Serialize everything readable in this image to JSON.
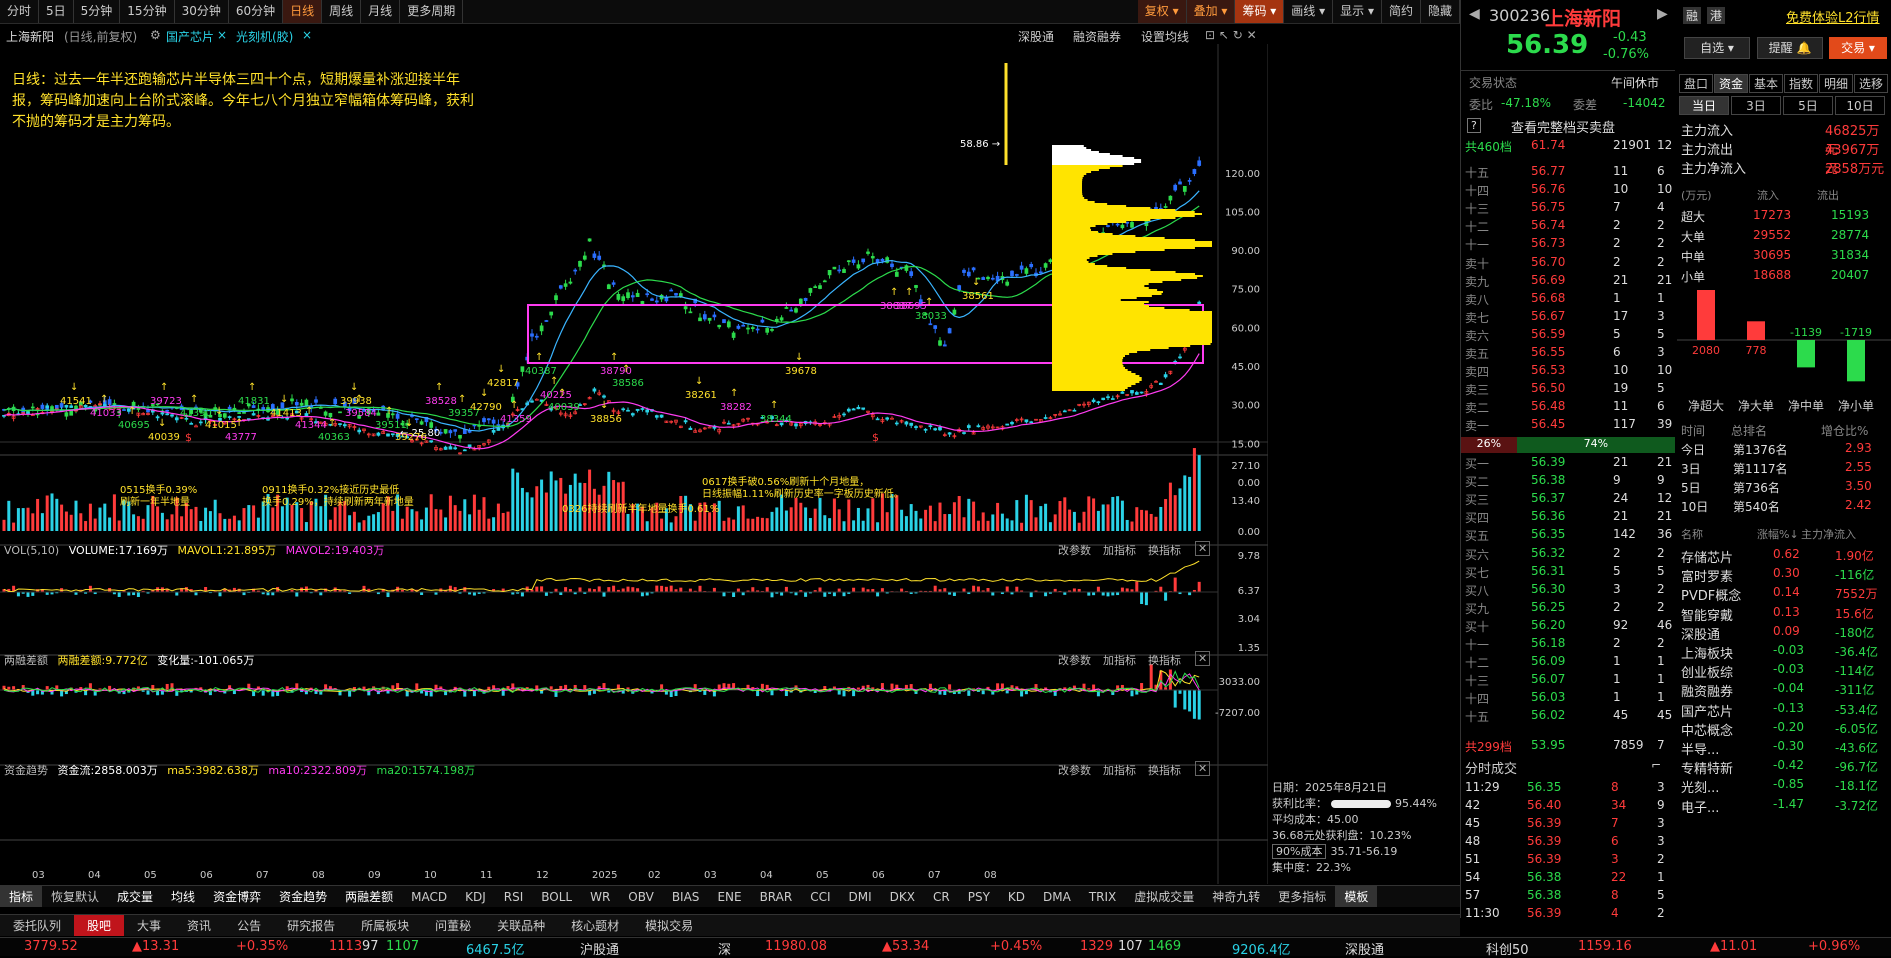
{
  "toolbar": {
    "periods": [
      "分时",
      "5日",
      "5分钟",
      "15分钟",
      "30分钟",
      "60分钟",
      "日线",
      "周线",
      "月线",
      "更多周期"
    ],
    "active": "日线",
    "right": [
      "复权",
      "叠加",
      "筹码",
      "画线",
      "显示",
      "简约",
      "隐藏"
    ]
  },
  "header": {
    "title": "上海新阳",
    "sub": "(日线,前复权)",
    "tag1": "国产芯片",
    "tag2": "光刻机(胶)",
    "links": [
      "深股通",
      "融资融券",
      "设置均线"
    ]
  },
  "annotation": "日线：过去一年半还跑输芯片半导体三四十个点，短期爆量补涨迎接半年报，筹码峰加速向上台阶式滚峰。今年七八个月独立窄幅箱体筹码峰，获利不抛的筹码才是主力筹码。",
  "price_axis": [
    "120.00",
    "105.00",
    "90.00",
    "75.00",
    "60.00",
    "45.00",
    "30.00",
    "15.00",
    "0.00"
  ],
  "markers": {
    "high": "58.86",
    "low": "25.80"
  },
  "chart_labels": [
    "41541",
    "41033",
    "40695",
    "40039",
    "39723",
    "41390",
    "41015",
    "43777",
    "41831",
    "41413",
    "41344",
    "40363",
    "39938",
    "39584",
    "39511",
    "39276",
    "38528",
    "39357",
    "42790",
    "41359",
    "40387",
    "42817",
    "40225",
    "40039",
    "38856",
    "38790",
    "38586",
    "38261",
    "38282",
    "38344",
    "39678",
    "38837",
    "38033",
    "38561",
    "38695"
  ],
  "vol": {
    "title": "VOL(5,10)",
    "volume": "VOLUME:17.169万",
    "ma1": "MAVOL1:21.895万",
    "ma2": "MAVOL2:19.403万",
    "axis": [
      "27.10",
      "13.40",
      "0.00"
    ],
    "notes": [
      "0515换手0.39%",
      "刷新一年半地量",
      "0911换手0.32%接近历史最低",
      "换手0.29%，持续刷新两年新地量",
      "0326持续刷新半年地量换手0.61%",
      "0617换手破0.56%刷新十个月地量，",
      "日线振幅1.11%刷新历史率一字板历史新低。"
    ]
  },
  "margin": {
    "title": "两融差额",
    "val": "两融差额:9.772亿",
    "chg": "变化量:-101.065万",
    "axis": [
      "9.78",
      "6.37",
      "3.04"
    ]
  },
  "flow": {
    "title": "资金趋势",
    "val": "资金流:2858.003万",
    "ma5": "ma5:3982.638万",
    "ma10": "ma10:2322.809万",
    "ma20": "ma20:1574.198万",
    "axis": [
      "1.35",
      "3033.00",
      "-7207.00"
    ]
  },
  "panel_btns": [
    "改参数",
    "加指标",
    "换指标"
  ],
  "chip": {
    "date": "日期：2025年8月21日",
    "ratio_lbl": "获利比率：",
    "ratio": "95.44%",
    "avg": "平均成本：45.00",
    "cost_lbl": "36.68元处获利盘：10.23%",
    "cost90": "90%成本",
    "cost_range": "35.71-56.19",
    "conc": "集中度：22.3%"
  },
  "xaxis": [
    "03",
    "04",
    "05",
    "06",
    "07",
    "08",
    "09",
    "10",
    "11",
    "12",
    "2025",
    "02",
    "03",
    "04",
    "05",
    "06",
    "07",
    "08"
  ],
  "bottom_tabs": [
    "指标",
    "恢复默认",
    "成交量",
    "均线",
    "资金博弈",
    "资金趋势",
    "两融差额",
    "MACD",
    "KDJ",
    "RSI",
    "BOLL",
    "WR",
    "OBV",
    "BIAS",
    "ENE",
    "BRAR",
    "CCI",
    "DMI",
    "DKX",
    "CR",
    "PSY",
    "KD",
    "DMA",
    "TRIX",
    "虚拟成交量",
    "神奇九转",
    "更多指标",
    "模板"
  ],
  "lower_tabs": [
    "委托队列",
    "股吧",
    "大事",
    "资讯",
    "公告",
    "研究报告",
    "所属板块",
    "问董秘",
    "关联品种",
    "核心题材",
    "模拟交易"
  ],
  "status": {
    "sh": "3779.52",
    "sh_chg": "▲13.31",
    "sh_pct": "+0.35%",
    "sh_up": "1113",
    "sh_eq": "97",
    "sh_dn": "1107",
    "sh_amt": "6467.5亿",
    "hgt": "沪股通",
    "sz_lbl": "深",
    "sz": "11980.08",
    "sz_chg": "▲53.34",
    "sz_pct": "+0.45%",
    "sz_up": "1329",
    "sz_eq": "107",
    "sz_dn": "1469",
    "sz_amt": "9206.4亿",
    "sgt": "深股通",
    "kc": "科创50",
    "kc_v": "1159.16",
    "kc_chg": "▲11.01",
    "kc_pct": "+0.96%"
  },
  "quote": {
    "code": "300236",
    "name": "上海新阳",
    "price": "56.39",
    "chg": "-0.43",
    "pct": "-0.76%",
    "btns": [
      "融",
      "港"
    ],
    "free": "免费体验L2行情",
    "zixuan": "自选",
    "remind": "提醒",
    "trade": "交易"
  },
  "trade_state": {
    "label": "交易状态",
    "value": "午间休市",
    "wb_lbl": "委比",
    "wb": "-47.18%",
    "wc_lbl": "委差",
    "wc": "-14042",
    "full": "查看完整档买卖盘"
  },
  "ask_total": {
    "lbl": "共460档",
    "p": "61.74",
    "v": "21901",
    "n": "12"
  },
  "asks": [
    [
      "十五",
      "56.77",
      "11",
      "6"
    ],
    [
      "十四",
      "56.76",
      "10",
      "10"
    ],
    [
      "十三",
      "56.75",
      "7",
      "4"
    ],
    [
      "十二",
      "56.74",
      "2",
      "2"
    ],
    [
      "十一",
      "56.73",
      "2",
      "2"
    ],
    [
      "卖十",
      "56.70",
      "2",
      "2"
    ],
    [
      "卖九",
      "56.69",
      "21",
      "21"
    ],
    [
      "卖八",
      "56.68",
      "1",
      "1"
    ],
    [
      "卖七",
      "56.67",
      "17",
      "3"
    ],
    [
      "卖六",
      "56.59",
      "5",
      "5"
    ],
    [
      "卖五",
      "56.55",
      "6",
      "3"
    ],
    [
      "卖四",
      "56.53",
      "10",
      "10"
    ],
    [
      "卖三",
      "56.50",
      "19",
      "5"
    ],
    [
      "卖二",
      "56.48",
      "11",
      "6"
    ],
    [
      "卖一",
      "56.45",
      "117",
      "39"
    ]
  ],
  "bar": {
    "l": "26%",
    "r": "74%"
  },
  "bids": [
    [
      "买一",
      "56.39",
      "21",
      "21"
    ],
    [
      "买二",
      "56.38",
      "9",
      "9"
    ],
    [
      "买三",
      "56.37",
      "24",
      "12"
    ],
    [
      "买四",
      "56.36",
      "21",
      "21"
    ],
    [
      "买五",
      "56.35",
      "142",
      "36"
    ],
    [
      "买六",
      "56.32",
      "2",
      "2"
    ],
    [
      "买七",
      "56.31",
      "5",
      "5"
    ],
    [
      "买八",
      "56.30",
      "3",
      "2"
    ],
    [
      "买九",
      "56.25",
      "2",
      "2"
    ],
    [
      "买十",
      "56.20",
      "92",
      "46"
    ],
    [
      "十一",
      "56.18",
      "2",
      "2"
    ],
    [
      "十二",
      "56.09",
      "1",
      "1"
    ],
    [
      "十三",
      "56.07",
      "1",
      "1"
    ],
    [
      "十四",
      "56.03",
      "1",
      "1"
    ],
    [
      "十五",
      "56.02",
      "45",
      "45"
    ]
  ],
  "bid_total": {
    "lbl": "共299档",
    "p": "53.95",
    "v": "7859",
    "n": "7"
  },
  "ticks_title": "分时成交",
  "ticks": [
    [
      "11:29",
      "56.35",
      "8",
      "3"
    ],
    [
      "42",
      "56.40",
      "34",
      "9"
    ],
    [
      "45",
      "56.39",
      "7",
      "3"
    ],
    [
      "48",
      "56.39",
      "6",
      "3"
    ],
    [
      "51",
      "56.39",
      "3",
      "2"
    ],
    [
      "54",
      "56.38",
      "22",
      "1"
    ],
    [
      "57",
      "56.38",
      "8",
      "5"
    ],
    [
      "11:30",
      "56.39",
      "4",
      "2"
    ]
  ],
  "right_tabs": [
    "盘口",
    "资金",
    "基本",
    "指数",
    "明细",
    "选移"
  ],
  "right_periods": [
    "当日",
    "3日",
    "5日",
    "10日"
  ],
  "main_flow": [
    [
      "主力流入",
      "46825万元"
    ],
    [
      "主力流出",
      "43967万元"
    ],
    [
      "主力净流入",
      "2858万元"
    ]
  ],
  "flow_tbl": {
    "hdr": [
      "(万元)",
      "流入",
      "流出"
    ],
    "rows": [
      [
        "超大",
        "17273",
        "15193"
      ],
      [
        "大单",
        "29552",
        "28774"
      ],
      [
        "中单",
        "30695",
        "31834"
      ],
      [
        "小单",
        "18688",
        "20407"
      ]
    ]
  },
  "net_bars": {
    "vals": [
      2080,
      778,
      -1139,
      -1719
    ],
    "labels": [
      "净超大",
      "净大单",
      "净中单",
      "净小单"
    ]
  },
  "rank": {
    "hdr": [
      "时间",
      "总排名",
      "增仓比%"
    ],
    "rows": [
      [
        "今日",
        "第1376名",
        "2.93"
      ],
      [
        "3日",
        "第1117名",
        "2.55"
      ],
      [
        "5日",
        "第736名",
        "3.50"
      ],
      [
        "10日",
        "第540名",
        "2.42"
      ]
    ]
  },
  "sectors": {
    "hdr": [
      "名称",
      "涨幅%",
      "主力净流入"
    ],
    "rows": [
      [
        "存储芯片",
        "0.62",
        "1.90亿"
      ],
      [
        "富时罗素",
        "0.30",
        "-116亿"
      ],
      [
        "PVDF概念",
        "0.14",
        "7552万"
      ],
      [
        "智能穿戴",
        "0.13",
        "15.6亿"
      ],
      [
        "深股通",
        "0.09",
        "-180亿"
      ],
      [
        "上海板块",
        "-0.03",
        "-36.4亿"
      ],
      [
        "创业板综",
        "-0.03",
        "-114亿"
      ],
      [
        "融资融券",
        "-0.04",
        "-311亿"
      ],
      [
        "国产芯片",
        "-0.13",
        "-53.4亿"
      ],
      [
        "中芯概念",
        "-0.20",
        "-6.05亿"
      ],
      [
        "半导...",
        "-0.30",
        "-43.6亿"
      ],
      [
        "专精特新",
        "-0.42",
        "-96.7亿"
      ],
      [
        "光刻...",
        "-0.85",
        "-18.1亿"
      ],
      [
        "电子...",
        "-1.47",
        "-3.72亿"
      ]
    ]
  }
}
